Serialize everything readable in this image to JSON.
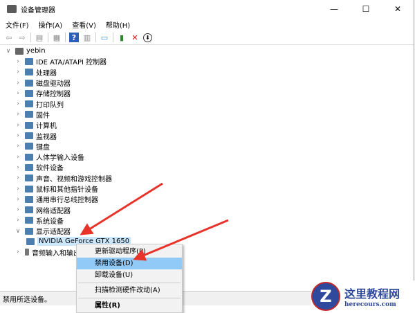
{
  "window": {
    "title": "设备管理器",
    "controls": [
      "—",
      "☐",
      "✕"
    ]
  },
  "menu": [
    "文件(F)",
    "操作(A)",
    "查看(V)",
    "帮助(H)"
  ],
  "toolbar": [
    "back-icon",
    "forward-icon",
    "properties-icon",
    "view-icon",
    "help-icon",
    "show-icon",
    "monitor-icon",
    "add-driver-icon",
    "remove-icon",
    "download-icon"
  ],
  "tree": {
    "root": "yebin",
    "items": [
      "IDE ATA/ATAPI 控制器",
      "处理器",
      "磁盘驱动器",
      "存储控制器",
      "打印队列",
      "固件",
      "计算机",
      "监视器",
      "键盘",
      "人体学输入设备",
      "软件设备",
      "声音、视频和游戏控制器",
      "鼠标和其他指针设备",
      "通用串行总线控制器",
      "网络适配器",
      "系统设备",
      "显示适配器"
    ],
    "child": "NVIDIA GeForce GTX 1650",
    "after": "音频输入和输出"
  },
  "context_menu": [
    "更新驱动程序(P)",
    "禁用设备(D)",
    "卸载设备(U)",
    "扫描检测硬件改动(A)",
    "属性(R)"
  ],
  "status": "禁用所选设备。",
  "logo": {
    "name": "这里教程网",
    "url": "herecours.com"
  }
}
